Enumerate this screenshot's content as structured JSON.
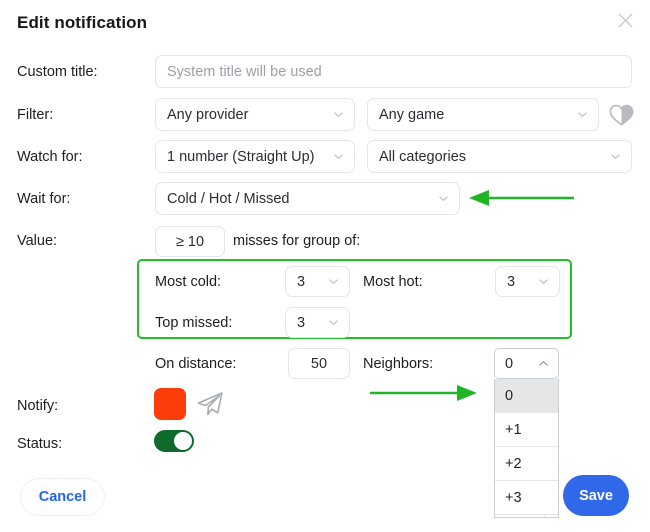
{
  "dialog": {
    "title": "Edit notification",
    "close_icon": "close-icon"
  },
  "fields": {
    "custom_title": {
      "label": "Custom title:",
      "value": "",
      "placeholder": "System title will be used"
    },
    "filter": {
      "label": "Filter:",
      "provider": "Any provider",
      "game": "Any game",
      "favorite_icon": "heart-icon"
    },
    "watch_for": {
      "label": "Watch for:",
      "bet_type": "1 number (Straight Up)",
      "categories": "All categories"
    },
    "wait_for": {
      "label": "Wait for:",
      "value": "Cold / Hot / Missed"
    },
    "value": {
      "label": "Value:",
      "input": "≥ 10",
      "suffix": "misses for group of:"
    },
    "group": {
      "most_cold_label": "Most cold:",
      "most_cold_value": "3",
      "most_hot_label": "Most hot:",
      "most_hot_value": "3",
      "top_missed_label": "Top missed:",
      "top_missed_value": "3"
    },
    "distance": {
      "label": "On distance:",
      "value": "50"
    },
    "neighbors": {
      "label": "Neighbors:",
      "value": "0",
      "options": [
        "0",
        "+1",
        "+2",
        "+3"
      ],
      "selected_index": 0,
      "expanded": true
    },
    "notify": {
      "label": "Notify:",
      "color": "#fc3d0a",
      "telegram_icon": "telegram-icon"
    },
    "status": {
      "label": "Status:",
      "enabled": true,
      "on_color": "#0f6b2b"
    }
  },
  "footer": {
    "cancel_label": "Cancel",
    "save_label": "Save",
    "save_color": "#2f68e8",
    "cancel_color": "#2563f6"
  },
  "annotations": {
    "arrow_color": "#22b425",
    "arrow_wait_for": "arrow-pointing-left-at-wait-for",
    "arrow_neighbors": "arrow-pointing-right-at-neighbors"
  }
}
